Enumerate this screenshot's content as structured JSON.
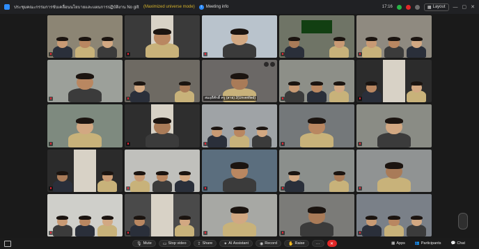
{
  "window": {
    "title": "ประชุมคณะกรรมการขับเคลื่อนนโยบายและแผนการปฏิบัติงาน No gift policy",
    "note": "(Maximized universe mode)",
    "meeting_info": "Meeting info",
    "time": "17:16",
    "layout_label": "Layout"
  },
  "tiles": [
    {
      "bg": "#8c8574",
      "name": ""
    },
    {
      "bg": "#3a3a3a",
      "name": ""
    },
    {
      "bg": "#b9c3cc",
      "name": ""
    },
    {
      "bg": "#6f7466",
      "name": ""
    },
    {
      "bg": "#8f8a80",
      "name": ""
    },
    {
      "bg": "#9ca09a",
      "name": ""
    },
    {
      "bg": "#6e6a63",
      "name": ""
    },
    {
      "bg": "#6b6866",
      "name": "สมฤดีศักดิ์ ครู (สาย) 2(Unverified)"
    },
    {
      "bg": "#8d8f88",
      "name": ""
    },
    {
      "bg": "#2c2c2c",
      "name": ""
    },
    {
      "bg": "#7e8a7f",
      "name": ""
    },
    {
      "bg": "#2e2e2e",
      "name": ""
    },
    {
      "bg": "#9fa3a6",
      "name": ""
    },
    {
      "bg": "#74787a",
      "name": ""
    },
    {
      "bg": "#8a8c85",
      "name": ""
    },
    {
      "bg": "#2b2b2b",
      "name": ""
    },
    {
      "bg": "#c0c0bc",
      "name": ""
    },
    {
      "bg": "#5b6e7e",
      "name": ""
    },
    {
      "bg": "#8b8f8c",
      "name": ""
    },
    {
      "bg": "#909393",
      "name": ""
    },
    {
      "bg": "#cfcfca",
      "name": ""
    },
    {
      "bg": "#4a4a4a",
      "name": ""
    },
    {
      "bg": "#a7a8a4",
      "name": ""
    },
    {
      "bg": "#7b7b78",
      "name": ""
    },
    {
      "bg": "#7a8088",
      "name": ""
    }
  ],
  "toolbar": {
    "mute": "Mute",
    "stop_video": "Stop video",
    "share": "Share",
    "ai_assistant": "AI Assistant",
    "record": "Record",
    "raise": "Raise",
    "apps": "Apps",
    "participants": "Participants",
    "chat": "Chat"
  }
}
